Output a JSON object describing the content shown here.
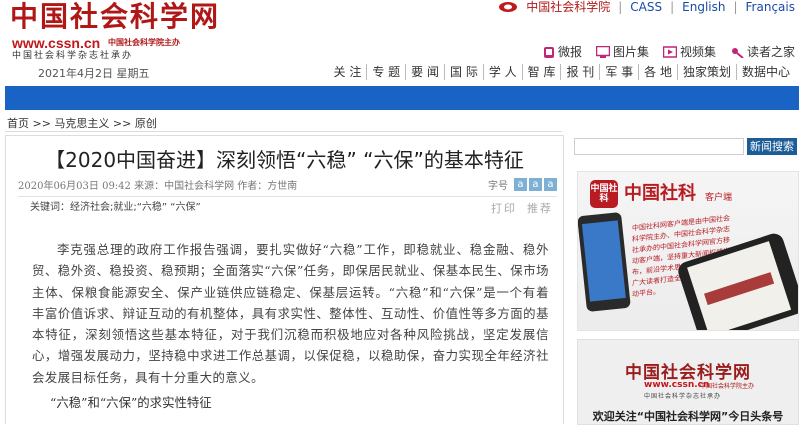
{
  "header": {
    "logo_title": "中国社会科学网",
    "logo_url": "www.cssn.cn",
    "logo_url_sub": "中国社会科学院主办",
    "logo_sub": "中国社会科学杂志社承办",
    "date": "2021年4月2日  星期五",
    "top_links": {
      "cass": "中国社会科学院",
      "cass_en": "CASS",
      "english": "English",
      "french": "Français"
    },
    "icon_links": [
      {
        "label": "微报",
        "icon": "weibao-icon"
      },
      {
        "label": "图片集",
        "icon": "gallery-icon"
      },
      {
        "label": "视频集",
        "icon": "video-icon"
      },
      {
        "label": "读者之家",
        "icon": "reader-icon"
      }
    ],
    "nav": [
      "关 注",
      "专 题",
      "要 闻",
      "国 际",
      "学 人",
      "智 库",
      "报 刊",
      "军 事",
      "各 地",
      "独家策划",
      "数据中心"
    ]
  },
  "breadcrumb": "首页 >> 马克思主义 >> 原创",
  "article": {
    "title": "【2020中国奋进】深刻领悟“六稳” “六保”的基本特征",
    "meta": "2020年06月03日 09:42 来源：中国社会科学网 作者：方世南",
    "fontsize_label": "字号",
    "fontsize_buttons": [
      "a",
      "a",
      "a"
    ],
    "keywords": "关键词：经济社会;就业;“六稳” “六保”",
    "actions": [
      "打印",
      "推荐"
    ],
    "paragraph": "李克强总理的政府工作报告强调，要扎实做好“六稳”工作，即稳就业、稳金融、稳外贸、稳外资、稳投资、稳预期；全面落实“六保”任务，即保居民就业、保基本民生、保市场主体、保粮食能源安全、保产业链供应链稳定、保基层运转。“六稳”和“六保”是一个有着丰富价值诉求、辩证互动的有机整体，具有求实性、整体性、互动性、价值性等多方面的基本特征，深刻领悟这些基本特征，对于我们沉稳而积极地应对各种风险挑战，坚定发展信心，增强发展动力，坚持稳中求进工作总基调，以保促稳，以稳助保，奋力实现全年经济社会发展目标任务，具有十分重大的意义。",
    "subheading": "“六稳”和“六保”的求实性特征"
  },
  "sidebar": {
    "search_button": "新闻搜索",
    "ad_app": {
      "logo_text": "中国社科",
      "title": "中国社科",
      "title_sub": "客户端",
      "description": "中国社科网客户端是由中国社会科学院主办、中国社会科学杂志社承办的中国社会科学网官方移动客户端，坚持重大新闻权威发布，前沿学术思想实时推送，为广大读者打造全媒体学术阅读互动平台。"
    },
    "ad_weibo": {
      "title": "中国社会科学网",
      "url": "www.cssn.cn",
      "url_sub": "中国社会科学院主办",
      "sub": "中国社会科学杂志社承办",
      "caption": "欢迎关注“中国社会科学网”今日头条号"
    }
  },
  "colors": {
    "brand_red": "#b01818",
    "nav_blue": "#1863c4",
    "search_button": "#1c5d98",
    "fontsize_button": "#7eb0d6"
  }
}
